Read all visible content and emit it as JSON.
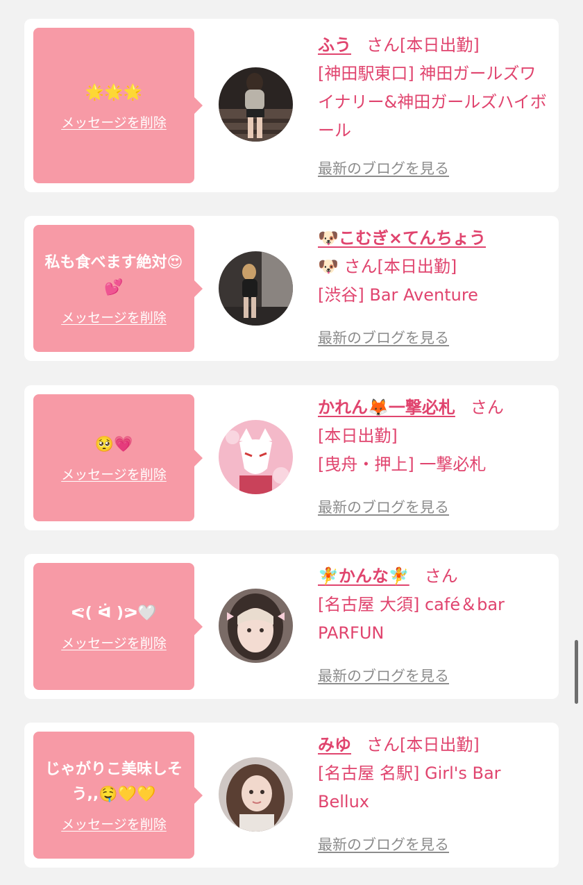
{
  "colors": {
    "page_background": "#f2f2f2",
    "bubble": "#f79aa6",
    "accent": "#e0446e",
    "link_gray": "#8c8c8c"
  },
  "delete_label": "メッセージを削除",
  "blog_label": "最新のブログを見る",
  "cards": [
    {
      "message": "🌟🌟🌟",
      "name": "ふう",
      "san": "さん",
      "status": "[本日出勤]",
      "shop": "[神田駅東口] 神田ガールズワイナリー&神田ガールズハイボール",
      "avatar_icon": "girl-on-stairs-photo"
    },
    {
      "message": "私も食べます絶対😍💕",
      "name": "🐶こむぎ×てんちょう",
      "san": "🐶 さん",
      "status": "[本日出勤]",
      "shop": "[渋谷] Bar Aventure",
      "avatar_icon": "girl-in-bar-photo"
    },
    {
      "message": "🥺💗",
      "name": "かれん🦊一撃必札",
      "san": "さん",
      "status": "[本日出勤]",
      "shop": "[曳舟・押上] 一撃必札",
      "avatar_icon": "fox-mask-photo"
    },
    {
      "message": "ᕙ( ᐛ )ᕗ🤍",
      "name": "🧚かんな🧚",
      "san": "さん",
      "status": "",
      "shop": "[名古屋 大須] café＆bar PARFUN",
      "avatar_icon": "girl-portrait-photo"
    },
    {
      "message": "じゃがりこ美味しそう,,🤤💛💛",
      "name": "みゆ",
      "san": "さん",
      "status": "[本日出勤]",
      "shop": "[名古屋 名駅] Girl's Bar Bellux",
      "avatar_icon": "girl-long-hair-photo"
    }
  ]
}
